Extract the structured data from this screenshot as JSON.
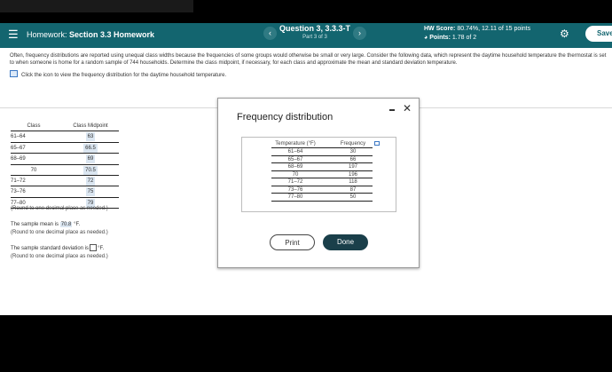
{
  "header": {
    "menu_glyph": "☰",
    "hw_prefix": "Homework:",
    "hw_title": "Section 3.3 Homework",
    "prev_glyph": "‹",
    "next_glyph": "›",
    "question": "Question 3, 3.3.3-T",
    "part": "Part 3 of 3",
    "score_label": "HW Score:",
    "score_value": "80.74%, 12.11 of 15 points",
    "points_glyph": "◕",
    "points_label": "Points:",
    "points_value": "1.78 of 2",
    "gear_glyph": "⚙",
    "save_label": "Save"
  },
  "question": {
    "text": "Often, frequency distributions are reported using unequal class widths because the frequencies of some groups would otherwise be small or very large. Consider the following data, which represent the daytime household temperature the thermostat is set to when someone is home for a random sample of 744 households. Determine the class midpoint, if necessary, for each class and approximate the mean and standard deviation temperature.",
    "click_text": "Click the icon to view the frequency distribution for the daytime household temperature."
  },
  "class_table": {
    "headers": [
      "Class",
      "Class Midpoint"
    ],
    "rows": [
      {
        "cls": "61–64",
        "mid": "63"
      },
      {
        "cls": "65–67",
        "mid": "66.5"
      },
      {
        "cls": "68–69",
        "mid": "69"
      },
      {
        "cls": "70",
        "mid": "70.5"
      },
      {
        "cls": "71–72",
        "mid": "72"
      },
      {
        "cls": "73–76",
        "mid": "75"
      },
      {
        "cls": "77–80",
        "mid": "79"
      }
    ],
    "round_note": "(Round to one decimal place as needed.)"
  },
  "mean": {
    "prefix": "The sample mean is",
    "value": "70.8",
    "unit": "°F.",
    "note": "(Round to one decimal place as needed.)"
  },
  "sd": {
    "prefix": "The sample standard deviation is",
    "unit": "°F.",
    "note": "(Round to one decimal place as needed.)"
  },
  "dialog": {
    "title": "Frequency distribution",
    "min_glyph": "",
    "close_glyph": "✕",
    "headers": [
      "Temperature (°F)",
      "Frequency"
    ],
    "rows": [
      {
        "t": "61–64",
        "f": "30"
      },
      {
        "t": "65–67",
        "f": "66"
      },
      {
        "t": "68–69",
        "f": "197"
      },
      {
        "t": "70",
        "f": "196"
      },
      {
        "t": "71–72",
        "f": "118"
      },
      {
        "t": "73–76",
        "f": "87"
      },
      {
        "t": "77–80",
        "f": "50"
      }
    ],
    "print_label": "Print",
    "done_label": "Done"
  }
}
